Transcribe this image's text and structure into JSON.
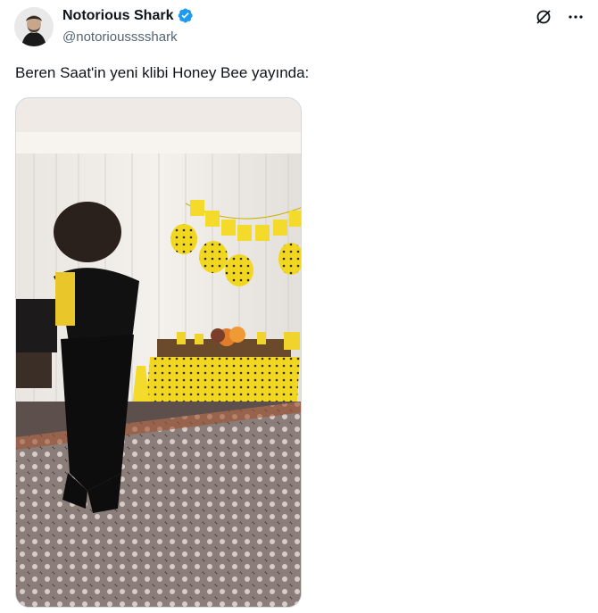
{
  "author": {
    "display_name": "Notorious Shark",
    "handle": "@notoriousssshark",
    "verified": true,
    "avatar_icon": "user-avatar"
  },
  "tweet": {
    "text": "Beren Saat'in yeni klibi Honey Bee yayında:"
  },
  "actions": {
    "grok_icon": "grok-icon",
    "more_icon": "more-icon"
  },
  "colors": {
    "verified_blue": "#1d9bf0",
    "text_primary": "#0f1419",
    "text_secondary": "#536471"
  }
}
